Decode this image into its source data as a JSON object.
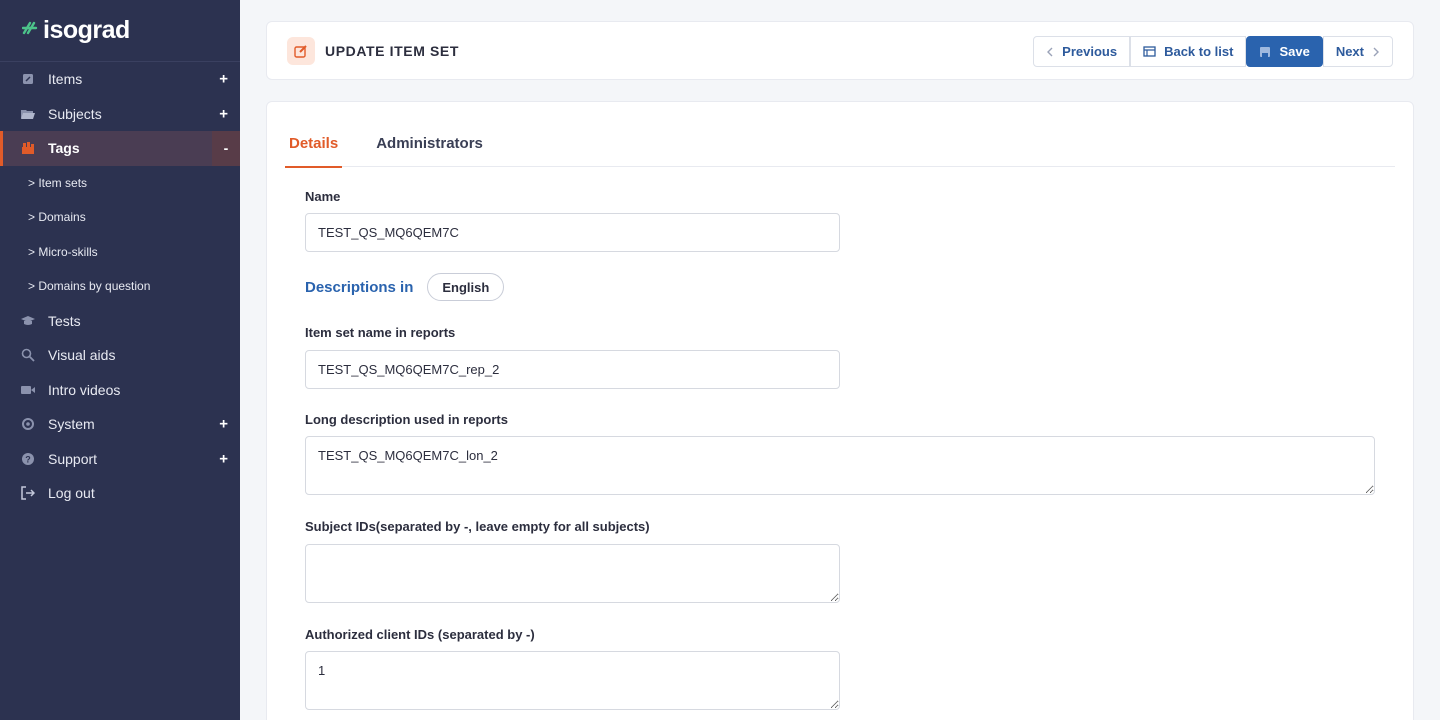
{
  "brand": {
    "mark": "≈",
    "name": "isograd"
  },
  "sidebar": {
    "items": [
      {
        "label": "Items",
        "toggle": "+"
      },
      {
        "label": "Subjects",
        "toggle": "+"
      },
      {
        "label": "Tags",
        "toggle": "-"
      },
      {
        "label": "Tests"
      },
      {
        "label": "Visual aids"
      },
      {
        "label": "Intro videos"
      },
      {
        "label": "System",
        "toggle": "+"
      },
      {
        "label": "Support",
        "toggle": "+"
      },
      {
        "label": "Log out"
      }
    ],
    "subitems": [
      "> Item sets",
      "> Domains",
      "> Micro-skills",
      "> Domains by question"
    ]
  },
  "header": {
    "title": "UPDATE ITEM SET",
    "buttons": {
      "previous": "Previous",
      "back": "Back to list",
      "save": "Save",
      "next": "Next"
    }
  },
  "tabs": [
    "Details",
    "Administrators"
  ],
  "form": {
    "name_label": "Name",
    "name_value": "TEST_QS_MQ6QEM7C",
    "descriptions_label": "Descriptions in",
    "language": "English",
    "report_name_label": "Item set name in reports",
    "report_name_value": "TEST_QS_MQ6QEM7C_rep_2",
    "long_desc_label": "Long description used in reports",
    "long_desc_value": "TEST_QS_MQ6QEM7C_lon_2",
    "subject_ids_label": "Subject IDs(separated by -, leave empty for all subjects)",
    "subject_ids_value": "",
    "client_ids_label": "Authorized client IDs (separated by -)",
    "client_ids_value": "1"
  },
  "colors": {
    "sidebar": "#2c3250",
    "accent": "#e15b29",
    "primary": "#2a63ae",
    "brand_mark": "#4cc38a"
  }
}
